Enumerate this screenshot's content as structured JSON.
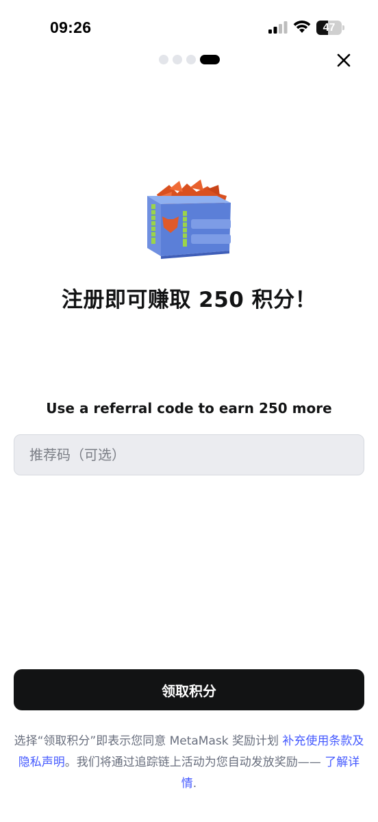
{
  "status_bar": {
    "time": "09:26",
    "battery_level": "47",
    "icons": [
      "signal-icon",
      "wifi-icon",
      "battery-icon"
    ]
  },
  "progress": {
    "total_steps": 4,
    "current_step": 4
  },
  "header": {
    "close_icon": "close-icon"
  },
  "illustration": {
    "name": "reward-box-illustration",
    "colors": {
      "box": "#5b7fd8",
      "fox": "#e05a2a",
      "stripe": "#9bd44a"
    }
  },
  "headline": "注册即可赚取 250 积分！",
  "referral": {
    "heading": "Use a referral code to earn 250 more",
    "input_value": "",
    "input_placeholder": "推荐码（可选）"
  },
  "claim_button_label": "领取积分",
  "legal": {
    "text_1": "选择“领取积分”即表示您同意 MetaMask 奖励计划 ",
    "link_terms": "补充使用条款及隐私声明",
    "text_2": "。我们将通过追踪链上活动为您自动发放奖励—— ",
    "link_learn_more": "了解详情",
    "text_3": "."
  },
  "colors": {
    "primary": "#121314",
    "link": "#4459ff",
    "input_bg": "#ebecf0",
    "muted_text": "#686e7d"
  }
}
